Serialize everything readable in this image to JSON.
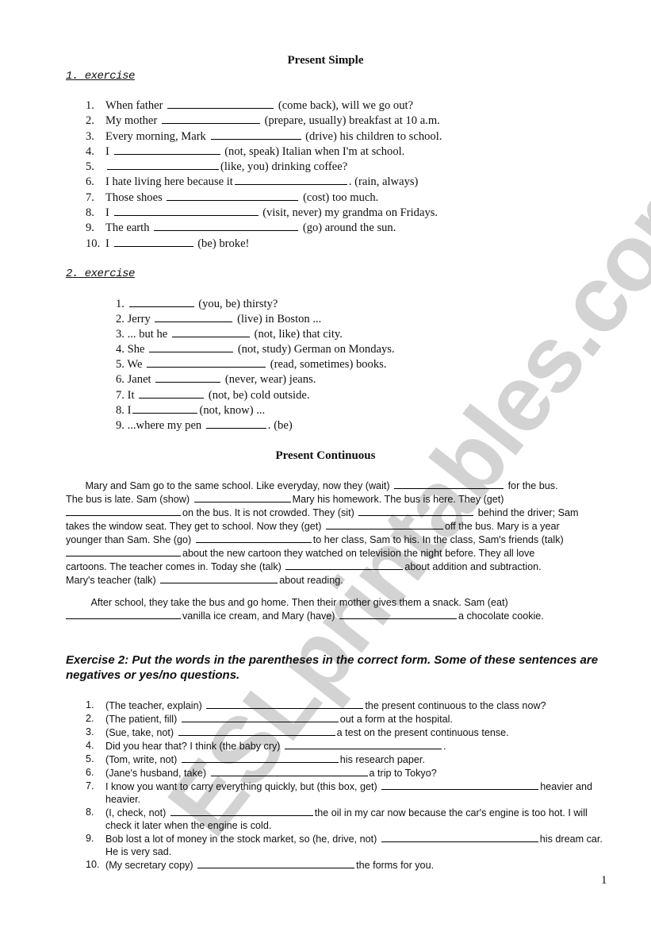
{
  "watermark": "ESLprintables.com",
  "page_number": "1",
  "present_simple": {
    "title": "Present Simple",
    "exercise1": {
      "heading": "1. exercise",
      "items": [
        {
          "num": "1.",
          "before": "When father",
          "after": "(come back), will we go out?"
        },
        {
          "num": "2.",
          "before": "My mother",
          "after": "(prepare, usually) breakfast at 10 a.m."
        },
        {
          "num": "3.",
          "before": "Every morning, Mark",
          "after": "(drive) his children to school."
        },
        {
          "num": "4.",
          "before": "I",
          "after": "(not, speak) Italian when I'm at school."
        },
        {
          "num": "5.",
          "before": "",
          "after": "(like, you) drinking coffee?"
        },
        {
          "num": "6.",
          "before": "I hate living here because it",
          "after": ". (rain, always)"
        },
        {
          "num": "7.",
          "before": "Those shoes",
          "after": "(cost) too much."
        },
        {
          "num": "8.",
          "before": "I",
          "after": "(visit, never) my grandma on Fridays."
        },
        {
          "num": "9.",
          "before": "The earth",
          "after": "(go) around the sun."
        },
        {
          "num": "10.",
          "before": "I",
          "after": "(be) broke!"
        }
      ]
    },
    "exercise2": {
      "heading": "2. exercise",
      "items": [
        {
          "num": "1.",
          "before": "",
          "after": "(you, be) thirsty?"
        },
        {
          "num": "2.",
          "before": "Jerry",
          "after": "(live) in Boston ..."
        },
        {
          "num": "3.",
          "before": "... but he",
          "after": "(not, like) that city."
        },
        {
          "num": "4.",
          "before": "She",
          "after": "(not, study) German on Mondays."
        },
        {
          "num": "5.",
          "before": "We",
          "after": "(read, sometimes) books."
        },
        {
          "num": "6.",
          "before": "Janet",
          "after": "(never, wear) jeans."
        },
        {
          "num": "7.",
          "before": "It",
          "after": "(not, be) cold outside."
        },
        {
          "num": "8.",
          "before": "I",
          "after": "(not, know) ..."
        },
        {
          "num": "9.",
          "before": "...where my pen",
          "after": ". (be)"
        }
      ]
    }
  },
  "present_continuous": {
    "title": "Present Continuous",
    "paragraph1": {
      "lines": [
        [
          "Mary and Sam go to the same school. Like everyday, now they (wait)",
          "for the bus."
        ],
        [
          "The bus is late. Sam (show)",
          "Mary his homework. The bus is here. They (get)"
        ],
        [
          "",
          "on the bus. It is not crowded. They (sit)",
          "behind the driver; Sam"
        ],
        [
          "takes the window seat. They get to school. Now they (get)",
          "off the bus. Mary is a year"
        ],
        [
          "younger than Sam. She (go)",
          "to her class, Sam to his. In the class, Sam's friends (talk)"
        ],
        [
          "",
          "about the new cartoon they watched on television the night before. They all love"
        ],
        [
          "cartoons. The teacher comes in. Today she (talk)",
          "about addition and subtraction."
        ],
        [
          "Mary's teacher (talk)",
          "about reading."
        ]
      ]
    },
    "paragraph2": {
      "lines": [
        [
          "After school, they take the bus and go home. Then their mother gives them a snack. Sam (eat)"
        ],
        [
          "",
          "vanilla ice cream, and Mary (have)",
          "a chocolate cookie."
        ]
      ]
    }
  },
  "exercise3": {
    "heading": "Exercise 2: Put the words in the parentheses in the correct form. Some of these sentences are negatives or yes/no questions.",
    "items": [
      {
        "num": "1.",
        "before": " (The teacher, explain)",
        "after": "the present continuous to the class now?"
      },
      {
        "num": "2.",
        "before": "(The patient, fill)",
        "after": "out a form at the hospital."
      },
      {
        "num": "3.",
        "before": "(Sue, take, not)",
        "after": "a test on the present continuous tense."
      },
      {
        "num": "4.",
        "before": "Did you hear that? I think (the baby cry)",
        "after": "."
      },
      {
        "num": "5.",
        "before": "(Tom, write, not)",
        "after": "his research paper."
      },
      {
        "num": "6.",
        "before": "(Jane's husband, take)",
        "after": "a trip to Tokyo?"
      },
      {
        "num": "7.",
        "before": "I know you want to carry everything quickly, but (this box, get)",
        "after": "heavier and heavier."
      },
      {
        "num": "8.",
        "before": "(I, check, not)",
        "after": "the oil in my car now because the car's engine is too hot. I will check it later when the engine is cold."
      },
      {
        "num": "9.",
        "before": "Bob lost a lot of money in the stock market, so (he, drive, not)",
        "after": "his dream car. He is very sad."
      },
      {
        "num": "10.",
        "before": "(My secretary copy)",
        "after": "the forms for you."
      }
    ]
  }
}
